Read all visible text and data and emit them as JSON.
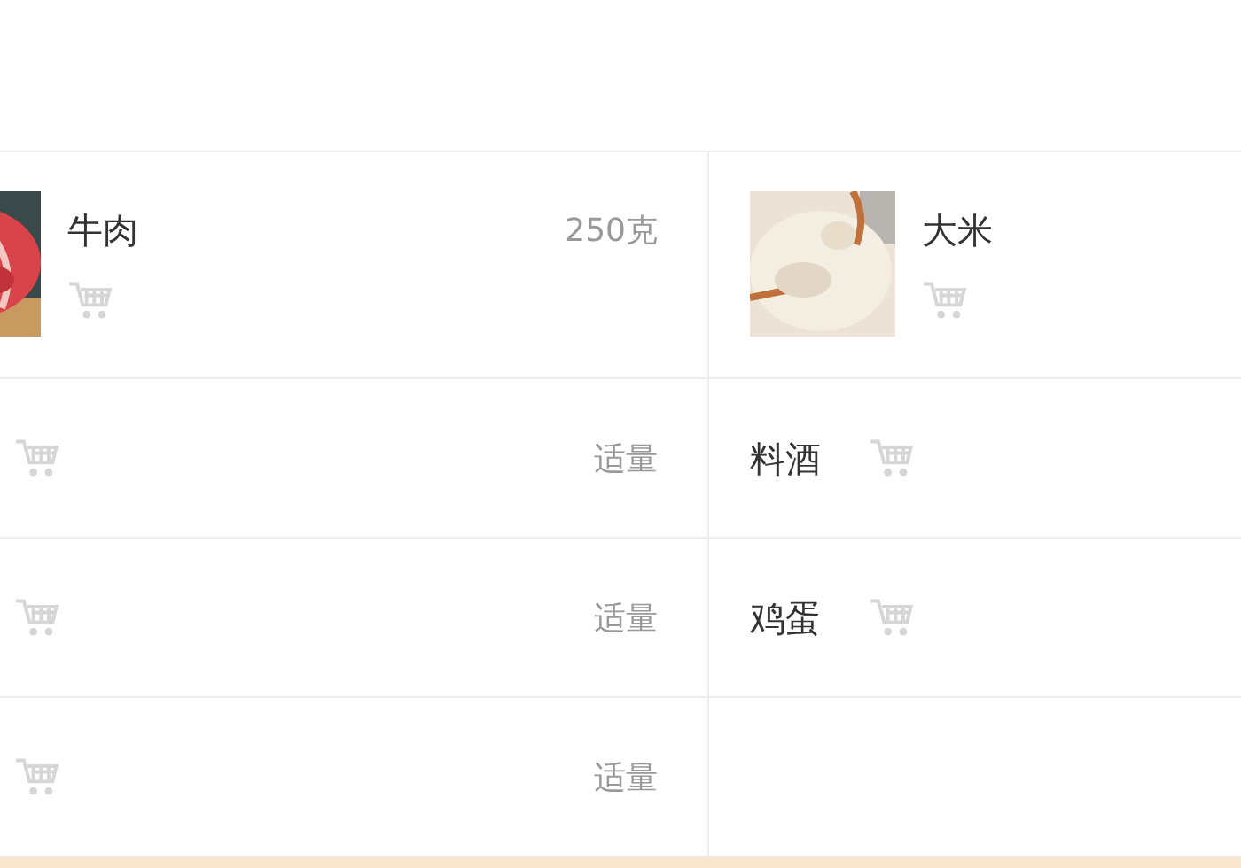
{
  "ingredients": [
    {
      "name": "牛肉",
      "amount": "250克"
    },
    {
      "name": "大米"
    },
    {
      "kind": "plain",
      "amount": "适量"
    },
    {
      "kind": "plain",
      "name": "料酒"
    },
    {
      "kind": "plain",
      "amount": "适量"
    },
    {
      "kind": "plain",
      "name": "鸡蛋"
    },
    {
      "kind": "plain",
      "amount": "适量"
    },
    {
      "kind": "empty"
    }
  ]
}
